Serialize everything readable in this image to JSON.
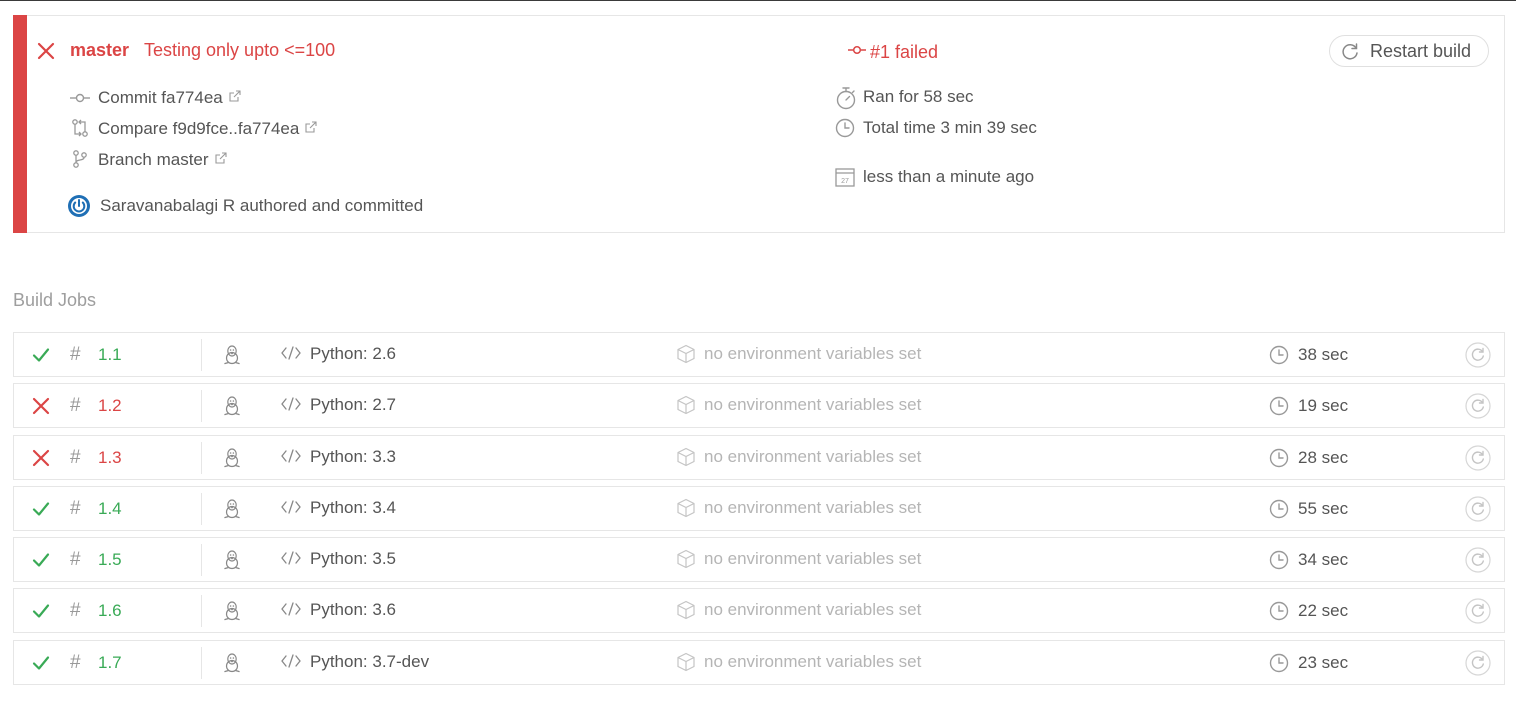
{
  "colors": {
    "failed": "#db4545",
    "passed": "#39aa56"
  },
  "build": {
    "status": "failed",
    "branch": "master",
    "message": "Testing only upto <=100",
    "commit_label": "Commit fa774ea",
    "compare_label": "Compare f9d9fce..fa774ea",
    "branch_label": "Branch master",
    "author_label": "Saravanabalagi R authored and committed",
    "state_label": "#1 failed",
    "ran_for": "Ran for 58 sec",
    "total_time": "Total time 3 min 39 sec",
    "finished": "less than a minute ago",
    "restart_label": "Restart build"
  },
  "jobs_heading": "Build Jobs",
  "jobs": [
    {
      "number": "1.1",
      "status": "passed",
      "os_icon": "linux-tux-icon",
      "language": "Python: 2.6",
      "env": "no environment variables set",
      "duration": "38 sec"
    },
    {
      "number": "1.2",
      "status": "failed",
      "os_icon": "linux-tux-icon",
      "language": "Python: 2.7",
      "env": "no environment variables set",
      "duration": "19 sec"
    },
    {
      "number": "1.3",
      "status": "failed",
      "os_icon": "linux-tux-icon",
      "language": "Python: 3.3",
      "env": "no environment variables set",
      "duration": "28 sec"
    },
    {
      "number": "1.4",
      "status": "passed",
      "os_icon": "linux-tux-icon",
      "language": "Python: 3.4",
      "env": "no environment variables set",
      "duration": "55 sec"
    },
    {
      "number": "1.5",
      "status": "passed",
      "os_icon": "linux-tux-icon",
      "language": "Python: 3.5",
      "env": "no environment variables set",
      "duration": "34 sec"
    },
    {
      "number": "1.6",
      "status": "passed",
      "os_icon": "linux-tux-icon",
      "language": "Python: 3.6",
      "env": "no environment variables set",
      "duration": "22 sec"
    },
    {
      "number": "1.7",
      "status": "passed",
      "os_icon": "linux-tux-icon",
      "language": "Python: 3.7-dev",
      "env": "no environment variables set",
      "duration": "23 sec"
    }
  ]
}
